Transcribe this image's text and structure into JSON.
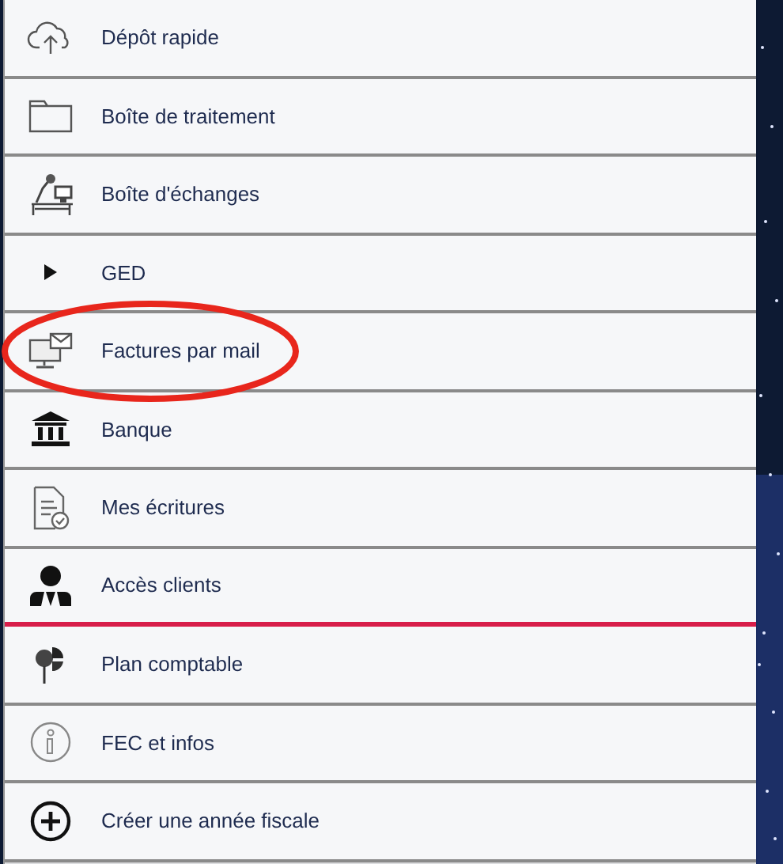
{
  "menu": {
    "items": [
      {
        "label": "Dépôt rapide",
        "selected": false,
        "circled": false
      },
      {
        "label": "Boîte de traitement",
        "selected": false,
        "circled": false
      },
      {
        "label": "Boîte d'échanges",
        "selected": false,
        "circled": false
      },
      {
        "label": "GED",
        "selected": false,
        "circled": false
      },
      {
        "label": "Factures par mail",
        "selected": false,
        "circled": true
      },
      {
        "label": "Banque",
        "selected": false,
        "circled": false
      },
      {
        "label": "Mes écritures",
        "selected": false,
        "circled": false
      },
      {
        "label": "Accès clients",
        "selected": true,
        "circled": false
      },
      {
        "label": "Plan comptable",
        "selected": false,
        "circled": false
      },
      {
        "label": "FEC et infos",
        "selected": false,
        "circled": false
      },
      {
        "label": "Créer une année fiscale",
        "selected": false,
        "circled": false
      }
    ]
  }
}
